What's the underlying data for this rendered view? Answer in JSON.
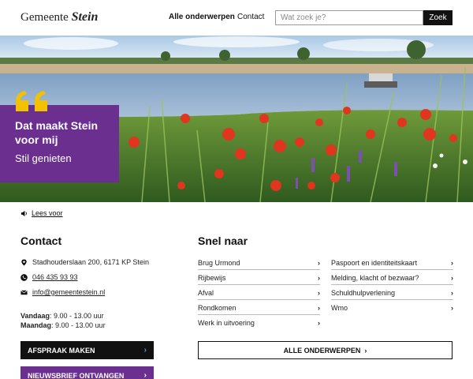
{
  "header": {
    "logo_prefix": "Gemeente",
    "logo_name": "Stein",
    "nav_all": "Alle onderwerpen",
    "nav_contact": "Contact",
    "search_placeholder": "Wat zoek je?",
    "search_button": "Zoek"
  },
  "hero": {
    "quote_title": "Dat maakt Stein voor mij",
    "quote_sub": "Stil genieten",
    "read_aloud": "Lees voor"
  },
  "contact": {
    "heading": "Contact",
    "address": "Stadhouderslaan 200, 6171 KP Stein",
    "phone": "046 435 93 93",
    "email": "info@gemeentestein.nl",
    "today_label": "Vandaag",
    "today_hours": ": 9.00 - 13.00 uur",
    "monday_label": "Maandag",
    "monday_hours": ": 9.00 - 13.00 uur",
    "appointment_button": "AFSPRAAK MAKEN",
    "newsletter_button": "NIEUWSBRIEF ONTVANGEN"
  },
  "snel": {
    "heading": "Snel naar",
    "left_links": [
      "Brug Urmond",
      "Rijbewijs",
      "Afval",
      "Rondkomen",
      "Werk in uitvoering"
    ],
    "right_links": [
      "Paspoort en identiteitskaart",
      "Melding, klacht of bezwaar?",
      "Schuldhulpverlening",
      "Wmo"
    ],
    "all_button": "ALLE ONDERWERPEN"
  },
  "colors": {
    "purple": "#6a2f8f",
    "quote_yellow": "#f2c200",
    "dark": "#111111"
  }
}
